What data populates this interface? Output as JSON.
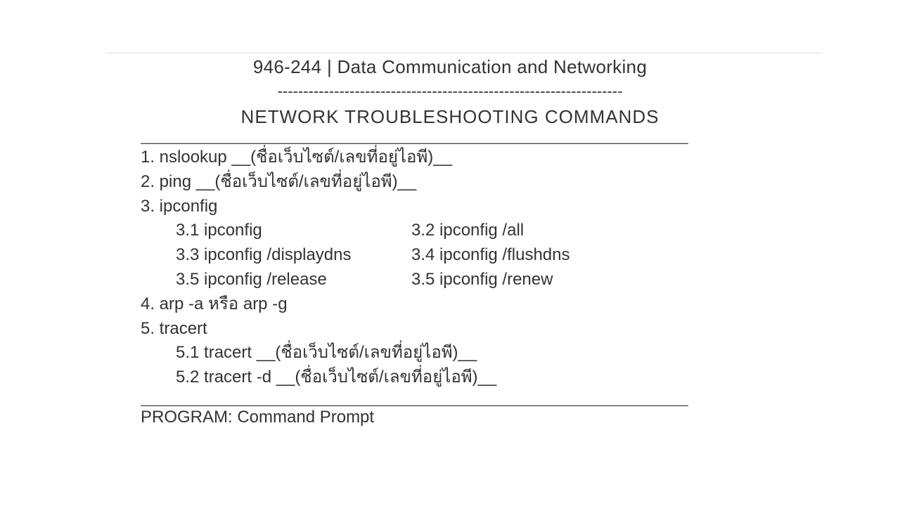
{
  "header": {
    "course_title": "946-244 | Data Communication and Networking",
    "dash_separator": "-------------------------------------------------------------------",
    "subtitle": "NETWORK TROUBLESHOOTING COMMANDS"
  },
  "rules": {
    "long_rule": "______________________________________________________________________"
  },
  "commands": {
    "item1": "1. nslookup __(ชื่อเว็บไซต์/เลขที่อยู่ไอพี)__",
    "item2": "2. ping __(ชื่อเว็บไซต์/เลขที่อยู่ไอพี)__",
    "item3": "3. ipconfig",
    "item3_1": "3.1 ipconfig",
    "item3_2": "3.2 ipconfig /all",
    "item3_3": "3.3 ipconfig /displaydns",
    "item3_4": "3.4 ipconfig /flushdns",
    "item3_5": "3.5 ipconfig /release",
    "item3_6": "3.5 ipconfig /renew",
    "item4": "4. arp -a หรือ arp -g",
    "item5": "5. tracert",
    "item5_1": "5.1 tracert __(ชื่อเว็บไซต์/เลขที่อยู่ไอพี)__",
    "item5_2": "5.2 tracert -d __(ชื่อเว็บไซต์/เลขที่อยู่ไอพี)__"
  },
  "program_line": "PROGRAM: Command Prompt"
}
